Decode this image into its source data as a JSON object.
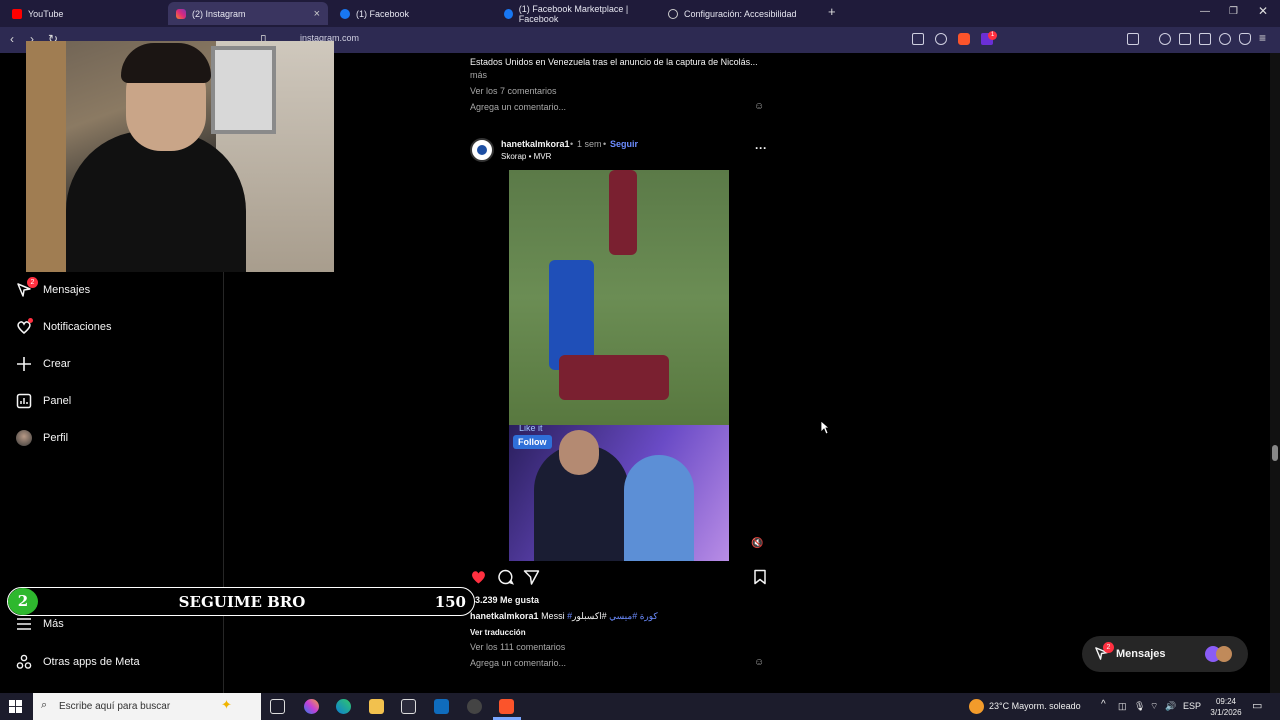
{
  "browser": {
    "tabs": [
      {
        "label": "YouTube",
        "icon": "youtube-icon",
        "color": "#ff0000"
      },
      {
        "label": "(2) Instagram",
        "icon": "instagram-icon",
        "color": "#e1306c",
        "active": true
      },
      {
        "label": "(1) Facebook",
        "icon": "facebook-icon",
        "color": "#1877f2"
      },
      {
        "label": "(1) Facebook Marketplace | Facebook",
        "icon": "facebook-icon",
        "color": "#1877f2"
      },
      {
        "label": "Configuración: Accesibilidad",
        "icon": "gear-icon",
        "color": "#cccccc"
      }
    ],
    "new_tab": "+",
    "url": "instagram.com",
    "notif_count": "1"
  },
  "sidebar": {
    "items": [
      {
        "label": "Mensajes",
        "icon": "messenger-icon",
        "badge": "2"
      },
      {
        "label": "Notificaciones",
        "icon": "heart-icon"
      },
      {
        "label": "Crear",
        "icon": "plus-icon"
      },
      {
        "label": "Panel",
        "icon": "chart-icon"
      },
      {
        "label": "Perfil",
        "icon": "avatar-icon"
      },
      {
        "label": "Más",
        "icon": "menu-icon"
      },
      {
        "label": "Otras apps de Meta",
        "icon": "meta-apps-icon"
      }
    ]
  },
  "prev_post": {
    "caption_line": "Estados Unidos en Venezuela tras el anuncio de la captura de Nicolás...",
    "more": "más",
    "comments": "Ver los 7 comentarios",
    "add_comment": "Agrega un comentario..."
  },
  "post": {
    "username": "hanetkalmkora1",
    "time": "1 sem",
    "separator": "•",
    "follow": "Seguir",
    "audio": "Skorap • MVR",
    "overlay_like": "Like it",
    "overlay_follow": "Follow",
    "likes": "43.239 Me gusta",
    "caption_user": "hanetkalmkora1",
    "caption_text": "Messi",
    "caption_tags": "#كورة #ميسي",
    "caption_tag2": "#اكسبلور",
    "translate": "Ver traducción",
    "comments": "Ver los 111 comentarios",
    "add_comment": "Agrega un comentario..."
  },
  "stream": {
    "number": "2",
    "message": "SEGUIME BRO",
    "count": "150"
  },
  "messages_bubble": {
    "label": "Mensajes",
    "badge": "2"
  },
  "taskbar": {
    "search_placeholder": "Escribe aquí para buscar",
    "weather": "23°C  Mayorm. soleado",
    "lang": "ESP",
    "time": "09:24",
    "date": "3/1/2026"
  },
  "colors": {
    "like_red": "#ff3040",
    "link_blue": "#6c8cff",
    "stream_green": "#2eb82e"
  }
}
